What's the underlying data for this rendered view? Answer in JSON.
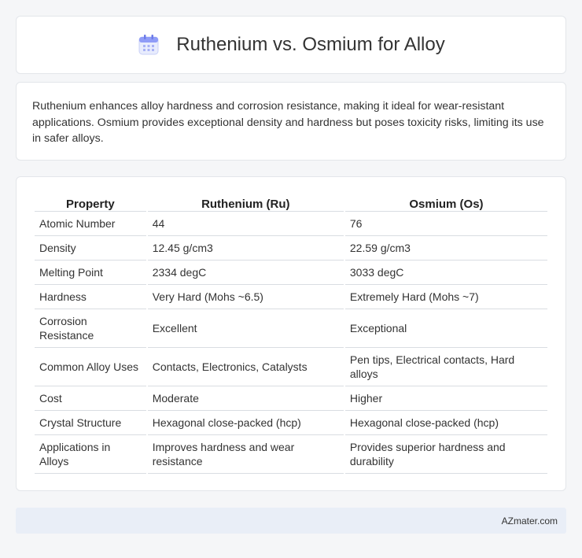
{
  "header": {
    "title": "Ruthenium vs. Osmium for Alloy",
    "icon": "calendar-icon",
    "accent": "#7e8cf5"
  },
  "summary": {
    "text": "Ruthenium enhances alloy hardness and corrosion resistance, making it ideal for wear-resistant applications. Osmium provides exceptional density and hardness but poses toxicity risks, limiting its use in safer alloys."
  },
  "table": {
    "headers": [
      "Property",
      "Ruthenium (Ru)",
      "Osmium (Os)"
    ],
    "rows": [
      [
        "Atomic Number",
        "44",
        "76"
      ],
      [
        "Density",
        "12.45 g/cm3",
        "22.59 g/cm3"
      ],
      [
        "Melting Point",
        "2334 degC",
        "3033 degC"
      ],
      [
        "Hardness",
        "Very Hard (Mohs ~6.5)",
        "Extremely Hard (Mohs ~7)"
      ],
      [
        "Corrosion Resistance",
        "Excellent",
        "Exceptional"
      ],
      [
        "Common Alloy Uses",
        "Contacts, Electronics, Catalysts",
        "Pen tips, Electrical contacts, Hard alloys"
      ],
      [
        "Cost",
        "Moderate",
        "Higher"
      ],
      [
        "Crystal Structure",
        "Hexagonal close-packed (hcp)",
        "Hexagonal close-packed (hcp)"
      ],
      [
        "Applications in Alloys",
        "Improves hardness and wear resistance",
        "Provides superior hardness and durability"
      ]
    ]
  },
  "footer": {
    "text": "AZmater.com"
  }
}
